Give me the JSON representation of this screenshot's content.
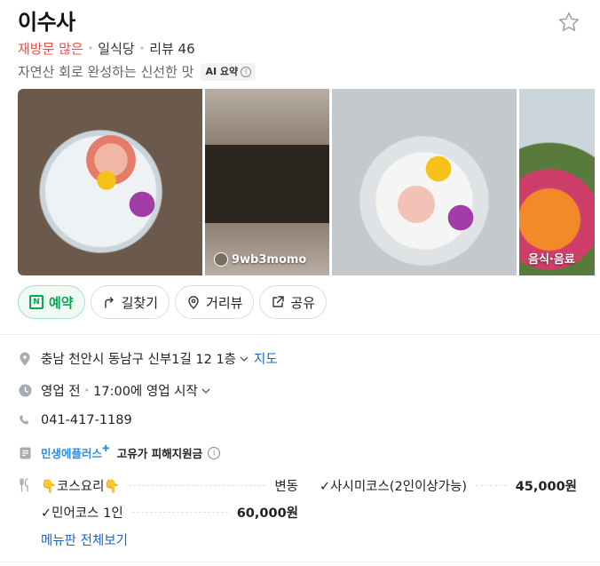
{
  "place": {
    "name": "이수사",
    "revisit_tag": "재방문 많은",
    "category": "일식당",
    "reviews": "리뷰 46",
    "summary": "자연산 회로 완성하는 신선한 맛",
    "ai_chip": "AI 요약"
  },
  "photos": [
    {
      "label": ""
    },
    {
      "label": "9wb3momo"
    },
    {
      "label": ""
    },
    {
      "label": "음식·음료"
    }
  ],
  "actions": [
    {
      "label": "예약",
      "icon": "naver-reservation-icon"
    },
    {
      "label": "길찾기",
      "icon": "directions-icon"
    },
    {
      "label": "거리뷰",
      "icon": "street-view-icon"
    },
    {
      "label": "공유",
      "icon": "share-icon"
    }
  ],
  "info": {
    "address": "충남 천안시 동남구 신부1길 12 1층",
    "map_link": "지도",
    "status": "영업 전",
    "hours": "17:00에 영업 시작",
    "phone": "041-417-1189",
    "promo_blue": "민생에플러스",
    "promo_dark": "고유가 피해지원금"
  },
  "menu": {
    "items": [
      {
        "name": "👇코스요리👇",
        "price": "변동"
      },
      {
        "name": "✓사시미코스(2인이상가능)",
        "price": "45,000원"
      },
      {
        "name": "✓민어코스 1인",
        "price": "60,000원"
      }
    ],
    "view_all": "메뉴판 전체보기"
  },
  "colors": {
    "accent_green": "#03a94d",
    "revisit_red": "#e94d4d",
    "link_blue": "#1e64c8",
    "promo_blue": "#2d8be8"
  }
}
